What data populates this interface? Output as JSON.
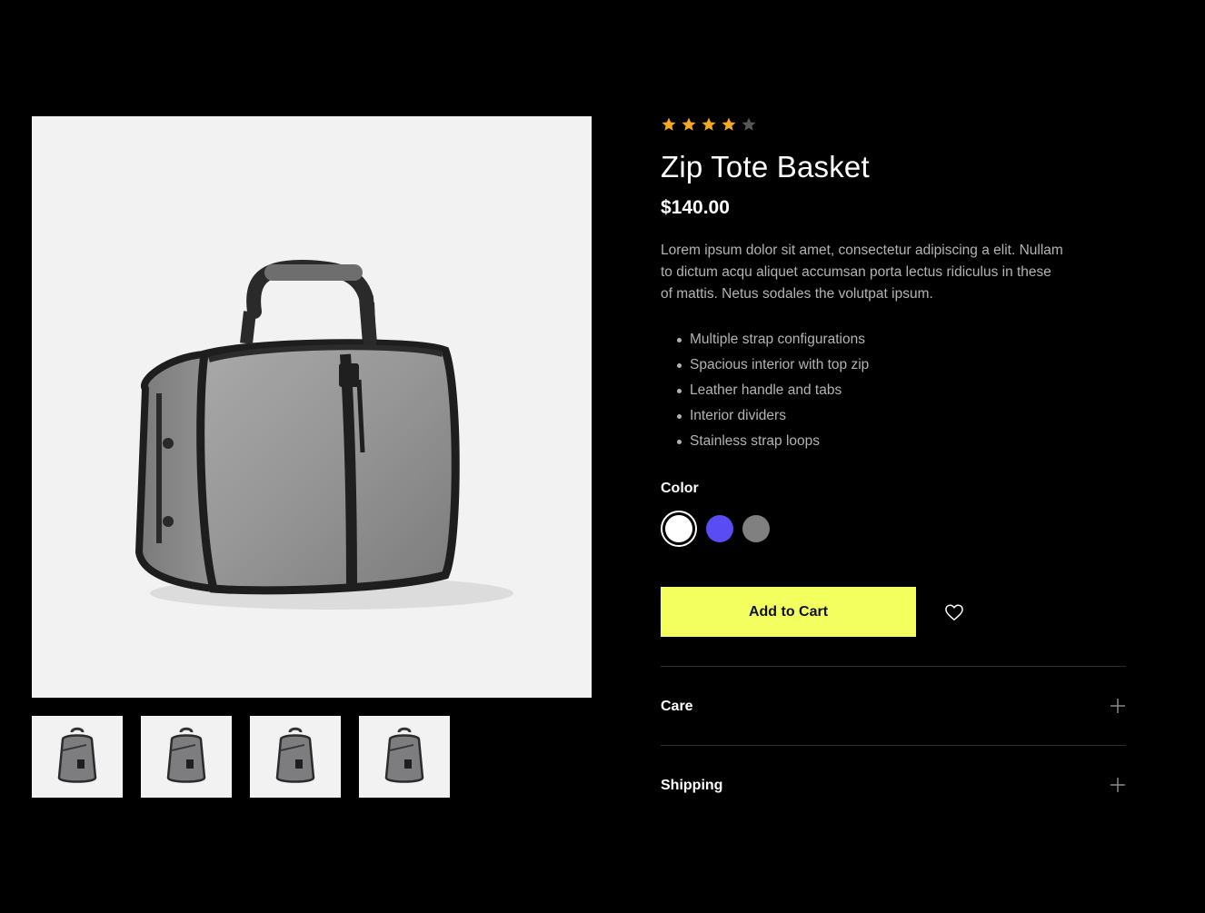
{
  "product": {
    "rating": 4,
    "rating_max": 5,
    "title": "Zip Tote Basket",
    "price": "$140.00",
    "description": "Lorem ipsum dolor sit amet, consectetur adipiscing a elit. Nullam to dictum acqu aliquet accumsan porta lectus ridiculus in these of mattis. Netus sodales the volutpat ipsum.",
    "features": [
      "Multiple strap configurations",
      "Spacious interior with top zip",
      "Leather handle and tabs",
      "Interior dividers",
      "Stainless strap loops"
    ]
  },
  "colors": {
    "label": "Color",
    "options": [
      {
        "name": "white",
        "hex": "#ffffff",
        "selected": true
      },
      {
        "name": "blue",
        "hex": "#5a4cf5",
        "selected": false
      },
      {
        "name": "gray",
        "hex": "#808080",
        "selected": false
      }
    ]
  },
  "actions": {
    "add_to_cart": "Add to Cart",
    "accent": "#f2ff5e"
  },
  "accordion": [
    {
      "label": "Care"
    },
    {
      "label": "Shipping"
    }
  ],
  "gallery": {
    "thumbnail_count": 4
  },
  "theme": {
    "background": "#000000",
    "star_filled": "#f5a623",
    "star_empty": "#555555"
  }
}
